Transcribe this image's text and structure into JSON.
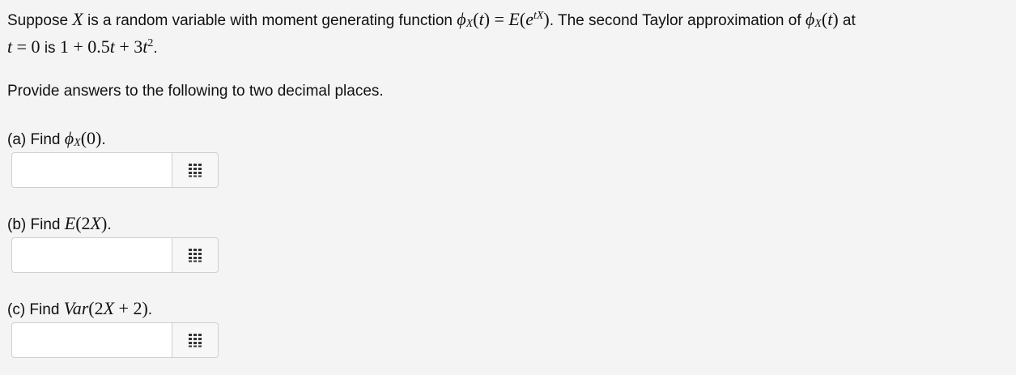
{
  "question": {
    "intro_text_1": "Suppose ",
    "intro_var": "X",
    "intro_text_2": " is a random variable with moment generating function ",
    "mgf_expr": "ϕ",
    "intro_text_3": ". The second Taylor approximation of ",
    "intro_text_4": " at",
    "point": "t = 0",
    "is_text": " is ",
    "approx_poly": "1 + 0.5t + 3t²",
    "instruction": "Provide answers to the following to two decimal places."
  },
  "parts": [
    {
      "label": "(a) Find ",
      "expr": "ϕX(0)",
      "input_value": "",
      "input_placeholder": ""
    },
    {
      "label": "(b) Find ",
      "expr": "E(2X)",
      "input_value": "",
      "input_placeholder": ""
    },
    {
      "label": "(c) Find ",
      "expr": "Var(2X + 2)",
      "input_value": "",
      "input_placeholder": ""
    }
  ],
  "icons": {
    "keypad": "keypad-icon"
  },
  "colors": {
    "background": "#f4f4f4",
    "input_border": "#cfcfcf",
    "keypad_icon": "#333333"
  }
}
